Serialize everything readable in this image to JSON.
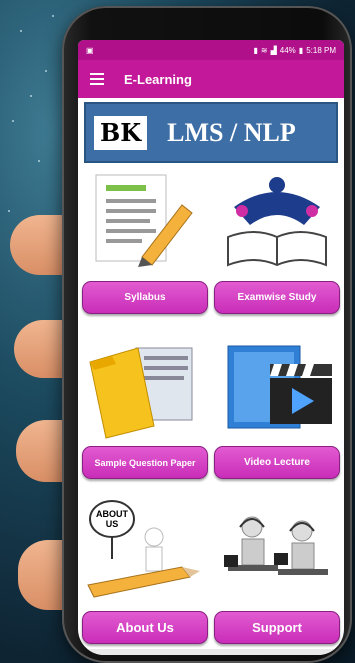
{
  "status_bar": {
    "time": "5:18 PM",
    "battery": "44%",
    "icons": [
      "image-icon",
      "vibrate-icon",
      "wifi-icon",
      "signal-icon",
      "battery-icon"
    ]
  },
  "app_bar": {
    "title": "E-Learning",
    "menu_icon": "hamburger-icon"
  },
  "banner": {
    "logo_text": "BK",
    "title": "LMS / NLP",
    "background": "#3d6ea6"
  },
  "tiles": [
    {
      "label": "Syllabus",
      "icon": "document-pencil-icon"
    },
    {
      "label": "Examwise Study",
      "icon": "reading-people-book-icon"
    },
    {
      "label": "Sample Question Paper",
      "icon": "folder-papers-icon"
    },
    {
      "label": "Video Lecture",
      "icon": "video-clapper-icon"
    },
    {
      "label": "About Us",
      "icon": "about-us-sign-icon"
    },
    {
      "label": "Support",
      "icon": "support-headset-icon"
    }
  ],
  "colors": {
    "primary": "#c4189a",
    "status": "#b0118a",
    "button": "#d03fc0"
  }
}
